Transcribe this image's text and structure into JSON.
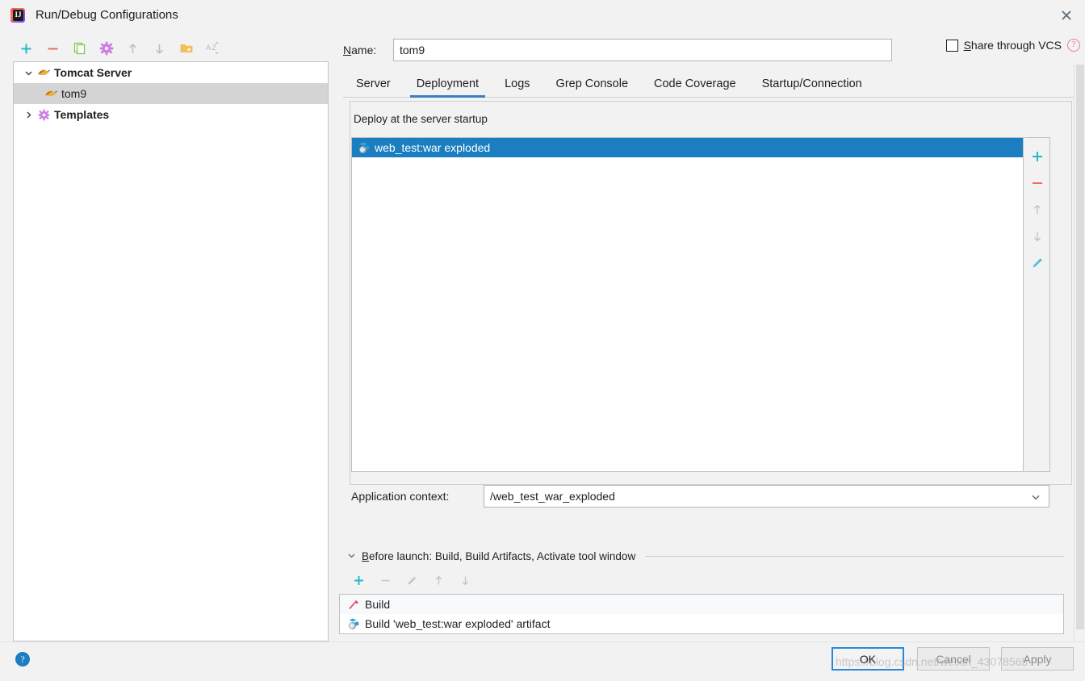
{
  "window": {
    "title": "Run/Debug Configurations",
    "app_icon": "intellij-idea-logo",
    "close_label": "✕"
  },
  "left_toolbar": {
    "buttons": [
      {
        "name": "add-configuration-button",
        "icon": "plus-icon",
        "label": "+",
        "enabled": true
      },
      {
        "name": "remove-configuration-button",
        "icon": "minus-icon",
        "label": "–",
        "enabled": true
      },
      {
        "name": "copy-configuration-button",
        "icon": "copy-icon",
        "label": "",
        "enabled": true
      },
      {
        "name": "edit-templates-button",
        "icon": "gear-icon",
        "label": "",
        "enabled": true
      },
      {
        "name": "move-up-button",
        "icon": "arrow-up-icon",
        "label": "↑",
        "enabled": false
      },
      {
        "name": "move-down-button",
        "icon": "arrow-down-icon",
        "label": "↓",
        "enabled": false
      },
      {
        "name": "new-folder-button",
        "icon": "folder-add-icon",
        "label": "",
        "enabled": true
      },
      {
        "name": "sort-alphabetically-button",
        "icon": "sort-az-icon",
        "label": "AŹ",
        "enabled": false
      }
    ]
  },
  "tree": {
    "items": [
      {
        "label": "Tomcat Server",
        "icon": "tomcat-cat-icon",
        "twisty": "⌄",
        "expanded": true,
        "level": 0,
        "bold": true,
        "selected": false
      },
      {
        "label": "tom9",
        "icon": "tomcat-cat-icon",
        "twisty": "",
        "expanded": false,
        "level": 1,
        "bold": false,
        "selected": true
      },
      {
        "label": "Templates",
        "icon": "gear-purple-icon",
        "twisty": "›",
        "expanded": false,
        "level": 0,
        "bold": true,
        "selected": false
      }
    ]
  },
  "name_field": {
    "label_prefix": "N",
    "label_rest": "ame:",
    "value": "tom9",
    "placeholder": ""
  },
  "share_vcs": {
    "label_prefix": "S",
    "label_rest": "hare through VCS",
    "checked": false,
    "help_glyph": "?"
  },
  "tabs": [
    {
      "label": "Server",
      "active": false
    },
    {
      "label": "Deployment",
      "active": true
    },
    {
      "label": "Logs",
      "active": false
    },
    {
      "label": "Grep Console",
      "active": false
    },
    {
      "label": "Code Coverage",
      "active": false
    },
    {
      "label": "Startup/Connection",
      "active": false
    }
  ],
  "deployment": {
    "group_legend": "Deploy at the server startup",
    "items": [
      {
        "label": "web_test:war exploded",
        "icon": "artifact-icon",
        "selected": true
      }
    ],
    "side_buttons": [
      {
        "name": "add-artifact-button",
        "icon": "plus-icon",
        "label": "+",
        "enabled": true
      },
      {
        "name": "remove-artifact-button",
        "icon": "minus-icon",
        "label": "–",
        "enabled": true
      },
      {
        "name": "move-artifact-up-button",
        "icon": "arrow-up-icon",
        "label": "↑",
        "enabled": false
      },
      {
        "name": "move-artifact-down-button",
        "icon": "arrow-down-icon",
        "label": "↓",
        "enabled": false
      },
      {
        "name": "edit-artifact-button",
        "icon": "pencil-icon",
        "label": "",
        "enabled": true
      }
    ],
    "application_context": {
      "label": "Application context:",
      "value": "/web_test_war_exploded",
      "dropdown_glyph": "⌄"
    }
  },
  "before_launch": {
    "twisty": "⌄",
    "title_prefix": "B",
    "title_rest": "efore launch: Build, Build Artifacts, Activate tool window",
    "toolbar": [
      {
        "name": "add-task-button",
        "icon": "plus-icon",
        "label": "+",
        "enabled": true
      },
      {
        "name": "remove-task-button",
        "icon": "minus-icon",
        "label": "–",
        "enabled": false
      },
      {
        "name": "edit-task-button",
        "icon": "pencil-icon",
        "label": "",
        "enabled": false
      },
      {
        "name": "task-move-up-button",
        "icon": "arrow-up-icon",
        "label": "↑",
        "enabled": false
      },
      {
        "name": "task-move-down-button",
        "icon": "arrow-down-icon",
        "label": "↓",
        "enabled": false
      }
    ],
    "tasks": [
      {
        "label": "Build",
        "icon": "hammer-icon"
      },
      {
        "label": "Build 'web_test:war exploded' artifact",
        "icon": "artifact-icon"
      }
    ]
  },
  "bottom_bar": {
    "help_glyph": "?",
    "ok_label": "OK",
    "cancel_label": "Cancel",
    "apply_label": "Apply"
  },
  "watermark": {
    "text": "https://blog.csdn.net/weixin_43078565"
  },
  "colors": {
    "accent_blue": "#1a7ec0",
    "tab_underline": "#3d7ebd",
    "dialog_bg": "#f2f2f2",
    "list_bg": "#ffffff",
    "selection_grey": "#d4d4d4",
    "plus_teal": "#24b8c9",
    "minus_red": "#ee6a5c",
    "gear_purple": "#cc7ce0",
    "folder_orange": "#f5bd5c",
    "hammer_pink": "#e8436f",
    "pencil_cyan": "#4ec3e0"
  }
}
